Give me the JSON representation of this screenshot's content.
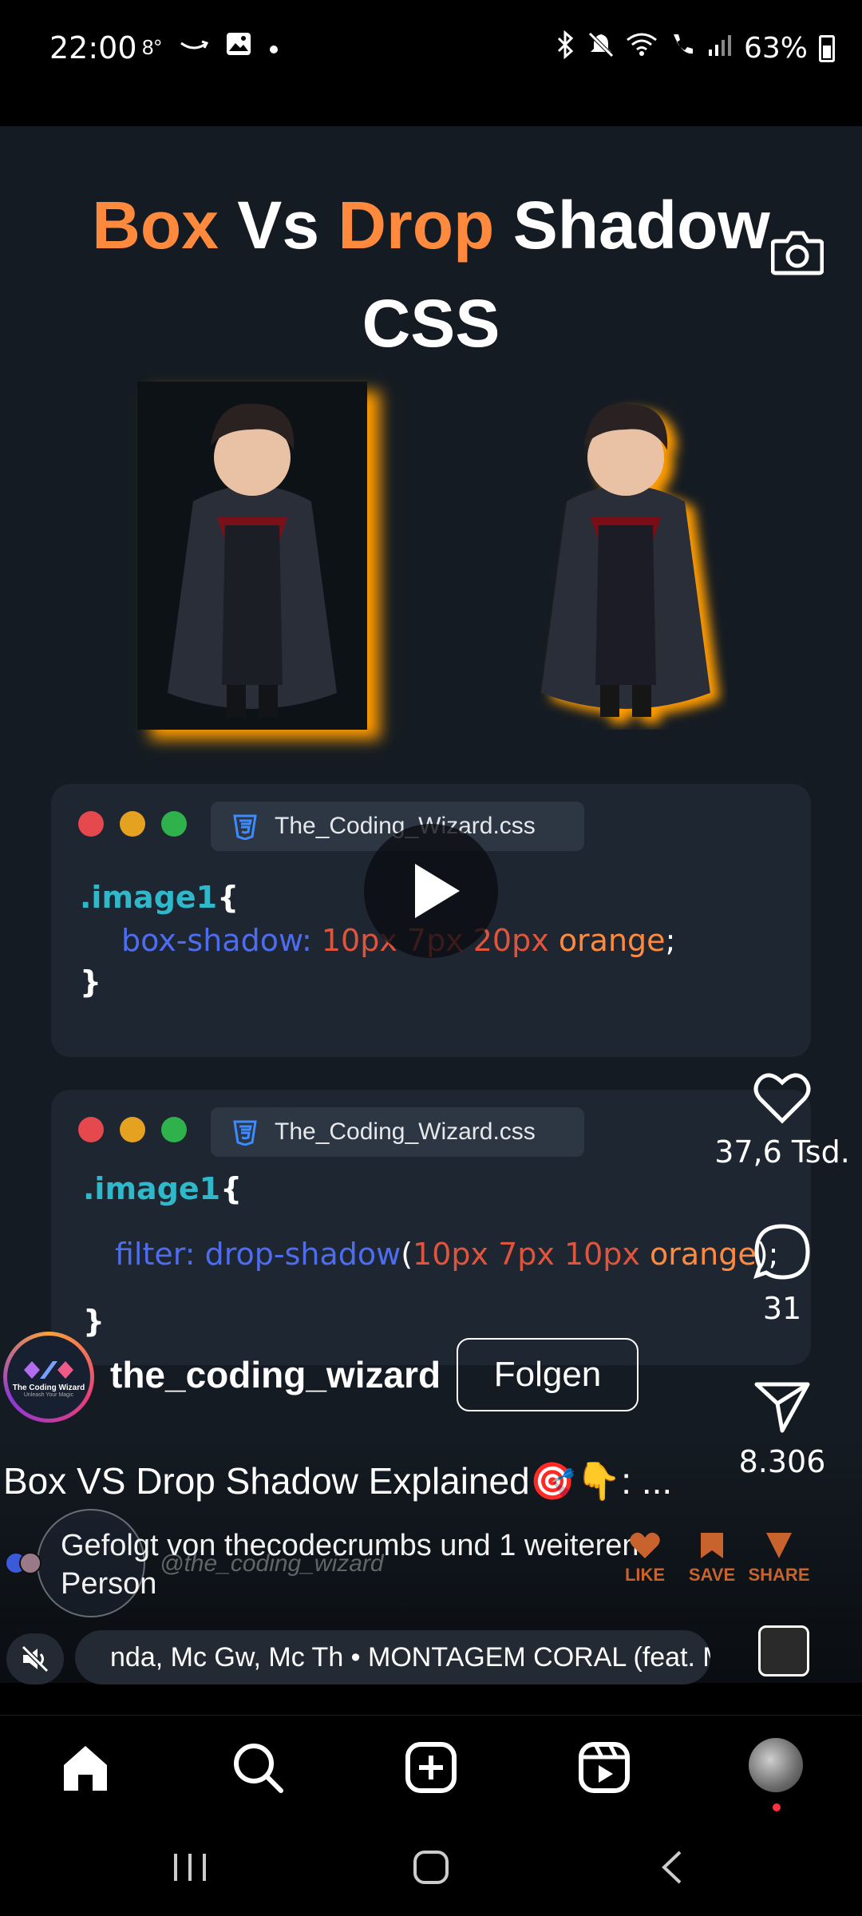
{
  "status_bar": {
    "time": "22:00",
    "temperature": "8°",
    "battery": "63%"
  },
  "reel": {
    "title_line1": {
      "w1": "Box",
      "w2": "Vs",
      "w3": "Drop",
      "w4": "Shadow"
    },
    "title_line2": "CSS",
    "code_panels": [
      {
        "filename": "The_Coding_Wizard.css",
        "selector": ".image1",
        "open_brace": "{",
        "close_brace": "}",
        "property": "box-shadow:",
        "value_nums": "10px 7px 20px",
        "value_kw": "orange",
        "end": ";"
      },
      {
        "filename": "The_Coding_Wizard.css",
        "selector": ".image1",
        "open_brace": "{",
        "close_brace": "}",
        "property": "filter: drop-shadow",
        "paren_open": "(",
        "value_nums": "10px 7px 10px",
        "value_kw": "orange",
        "end": ");"
      }
    ]
  },
  "actions": {
    "likes": "37,6 Tsd.",
    "comments": "31",
    "shares": "8.306"
  },
  "author": {
    "username": "the_coding_wizard",
    "follow_label": "Folgen",
    "avatar_text": "The Coding Wizard",
    "avatar_subtext": "Unleash Your Magic"
  },
  "caption": "Box VS Drop Shadow Explained🎯👇: ...",
  "followed_by": "Gefolgt von thecodecrumbs und 1 weiteren Person",
  "watermark": "@the_coding_wizard",
  "overlay_actions": {
    "like": "LIKE",
    "save": "SAVE",
    "share": "SHARE"
  },
  "music": {
    "track": "nda, Mc Gw, Mc Th • MONTAGEM CORAL (feat. Mc Cy"
  },
  "colors": {
    "accent_orange": "#ff8a3d",
    "background": "#141b22",
    "notification_red": "#ff3040"
  }
}
